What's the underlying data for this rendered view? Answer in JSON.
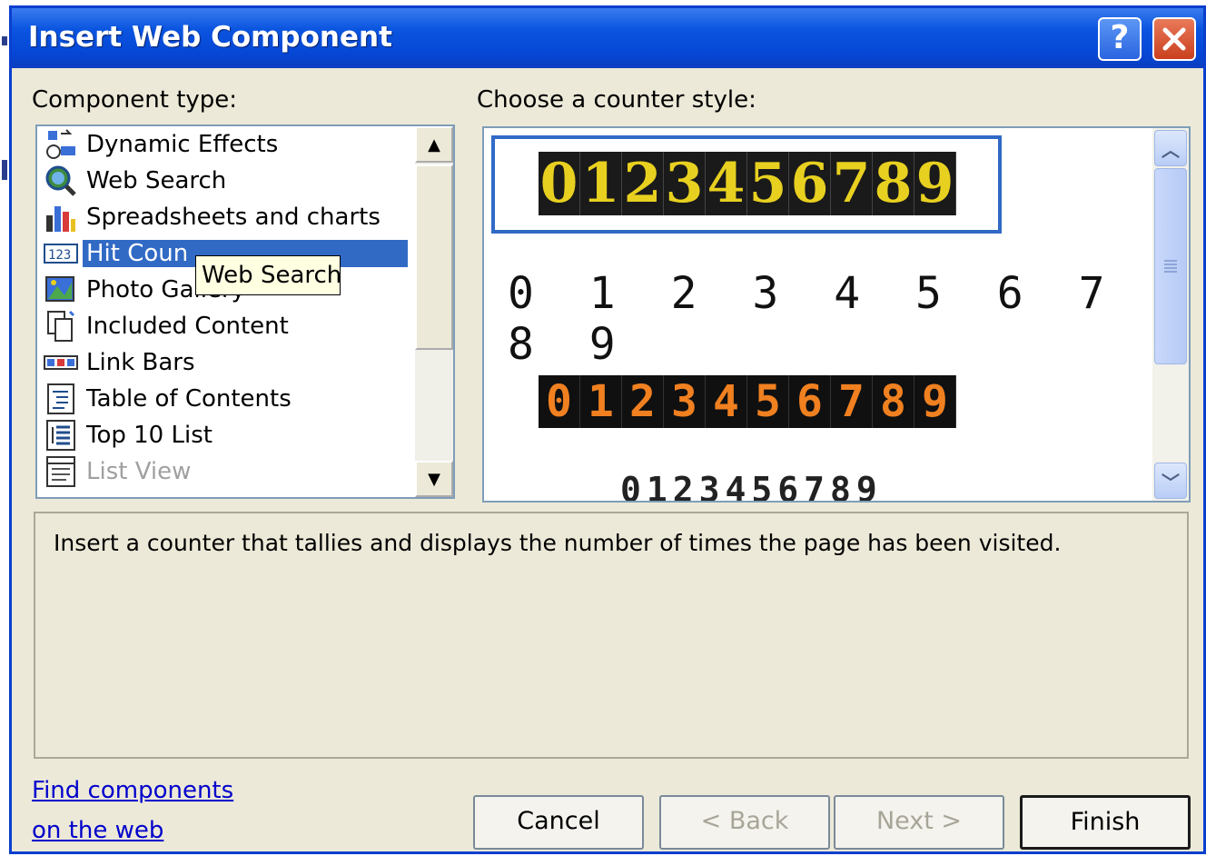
{
  "window": {
    "title": "Insert Web Component",
    "help_label": "?",
    "close_label": "✕"
  },
  "component_type": {
    "label": "Component type:",
    "items": [
      {
        "label": "Dynamic Effects",
        "icon": "dynamic-effects-icon",
        "state": "normal"
      },
      {
        "label": "Web Search",
        "icon": "web-search-icon",
        "state": "normal"
      },
      {
        "label": "Spreadsheets and charts",
        "icon": "spreadsheet-chart-icon",
        "state": "normal"
      },
      {
        "label": "Hit Coun",
        "icon": "hit-counter-icon",
        "state": "selected"
      },
      {
        "label": "Photo Gallery",
        "icon": "photo-gallery-icon",
        "state": "normal"
      },
      {
        "label": "Included Content",
        "icon": "included-content-icon",
        "state": "normal"
      },
      {
        "label": "Link Bars",
        "icon": "link-bars-icon",
        "state": "normal"
      },
      {
        "label": "Table of Contents",
        "icon": "table-of-contents-icon",
        "state": "normal"
      },
      {
        "label": "Top 10 List",
        "icon": "top-10-list-icon",
        "state": "normal"
      },
      {
        "label": "List View",
        "icon": "list-view-icon",
        "state": "disabled"
      }
    ],
    "tooltip": "Web Search"
  },
  "counter_style": {
    "label": "Choose a counter style:",
    "styles": [
      {
        "digits": "0123456789",
        "style": "gold-on-black",
        "selected": true
      },
      {
        "digits": "0 1 2 3 4 5 6 7 8 9",
        "style": "handwritten",
        "selected": false
      },
      {
        "digits": "0123456789",
        "style": "orange-on-black",
        "selected": false
      },
      {
        "digits": "0123456789",
        "style": "dark-condensed",
        "selected": false
      }
    ]
  },
  "description": "Insert a counter that tallies and displays the number of times the page has been visited.",
  "find_link": {
    "line1": "Find components",
    "line2": "on the web"
  },
  "buttons": {
    "cancel": "Cancel",
    "back": "< Back",
    "next": "Next >",
    "finish": "Finish"
  },
  "colors": {
    "titlebar": "#0A55E0",
    "selection": "#316AC5",
    "dialog_bg": "#ECE9D8",
    "link": "#0000CC"
  }
}
